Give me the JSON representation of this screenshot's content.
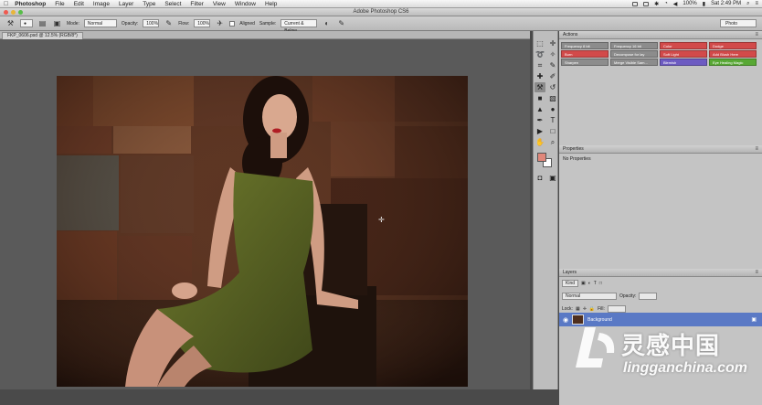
{
  "menubar": {
    "app": "Photoshop",
    "items": [
      "File",
      "Edit",
      "Image",
      "Layer",
      "Type",
      "Select",
      "Filter",
      "View",
      "Window",
      "Help"
    ],
    "battery": "100%",
    "clock": "Sat 2:49 PM"
  },
  "titlebar": {
    "title": "Adobe Photoshop CS6"
  },
  "options": {
    "mode_label": "Mode:",
    "mode_value": "Normal",
    "opacity_label": "Opacity:",
    "opacity_value": "100%",
    "flow_label": "Flow:",
    "flow_value": "100%",
    "aligned_label": "Aligned",
    "sample_label": "Sample:",
    "sample_value": "Current & Below",
    "workspace": "Photo"
  },
  "document": {
    "tab": "FKP_0606.psd @ 12.5% (RGB/8*)"
  },
  "actions": {
    "title": "Actions",
    "items": [
      {
        "label": "Frequency 8 bit",
        "color": "gray"
      },
      {
        "label": "Frequency 16 bit",
        "color": "gray"
      },
      {
        "label": "Color",
        "color": "red"
      },
      {
        "label": "Dodge",
        "color": "red"
      },
      {
        "label": "Burn",
        "color": "red"
      },
      {
        "label": "Decompose for lay",
        "color": "gray"
      },
      {
        "label": "Soft Light",
        "color": "red"
      },
      {
        "label": "Add Blush Here",
        "color": "red"
      },
      {
        "label": "Sharpen",
        "color": "gray"
      },
      {
        "label": "Merge Visible Sam...",
        "color": "gray"
      },
      {
        "label": "Blemish",
        "color": "purple"
      },
      {
        "label": "Eye Healing Magic",
        "color": "green"
      }
    ]
  },
  "properties": {
    "title": "Properties",
    "empty": "No Properties"
  },
  "layers": {
    "title": "Layers",
    "kind": "Kind",
    "blend": "Normal",
    "opacity_label": "Opacity:",
    "lock_label": "Lock:",
    "fill_label": "Fill:",
    "layer_name": "Background"
  },
  "watermark": {
    "cn": "灵感中国",
    "url": "lingganchina.com"
  }
}
